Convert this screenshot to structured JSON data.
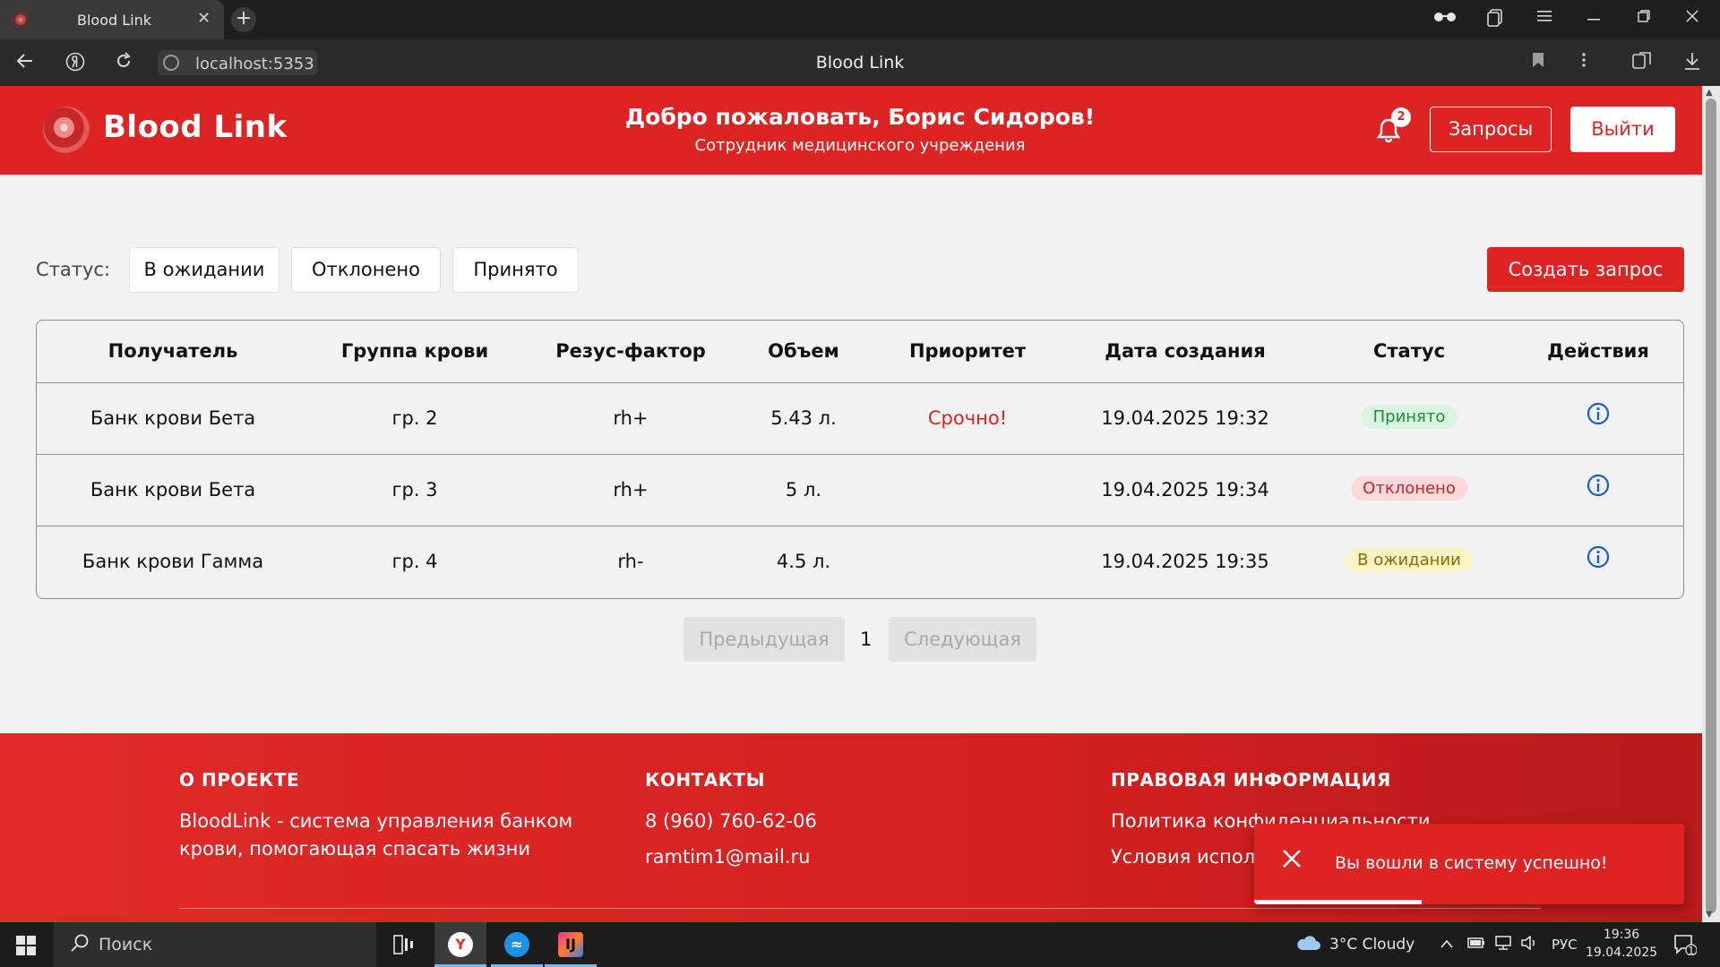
{
  "browser": {
    "tab_title": "Blood Link",
    "tab_close": "✕",
    "new_tab": "+",
    "url": "localhost:5353",
    "page_title": "Blood Link"
  },
  "header": {
    "brand": "Blood Link",
    "welcome": "Добро пожаловать, Борис Сидоров!",
    "role": "Сотрудник медицинского учреждения",
    "notification_count": "2",
    "requests_button": "Запросы",
    "logout_button": "Выйти"
  },
  "filters": {
    "label": "Статус:",
    "options": [
      "В ожидании",
      "Отклонено",
      "Принято"
    ],
    "create_button": "Создать запрос"
  },
  "table": {
    "columns": [
      "Получатель",
      "Группа крови",
      "Резус-фактор",
      "Объем",
      "Приоритет",
      "Дата создания",
      "Статус",
      "Действия"
    ],
    "rows": [
      {
        "recipient": "Банк крови Бета",
        "blood_group": "гр. 2",
        "rh": "rh+",
        "volume": "5.43 л.",
        "priority": "Срочно!",
        "created": "19.04.2025 19:32",
        "status": "Принято",
        "status_kind": "accepted"
      },
      {
        "recipient": "Банк крови Бета",
        "blood_group": "гр. 3",
        "rh": "rh+",
        "volume": "5 л.",
        "priority": "",
        "created": "19.04.2025 19:34",
        "status": "Отклонено",
        "status_kind": "rejected"
      },
      {
        "recipient": "Банк крови Гамма",
        "blood_group": "гр. 4",
        "rh": "rh-",
        "volume": "4.5 л.",
        "priority": "",
        "created": "19.04.2025 19:35",
        "status": "В ожидании",
        "status_kind": "pending"
      }
    ]
  },
  "pagination": {
    "prev": "Предыдущая",
    "page": "1",
    "next": "Следующая"
  },
  "footer": {
    "about_title": "О ПРОЕКТЕ",
    "about_line1": "BloodLink - система управления банком",
    "about_line2": "крови, помогающая спасать жизни",
    "contacts_title": "КОНТАКТЫ",
    "phone": "8 (960) 760-62-06",
    "email": "ramtim1@mail.ru",
    "legal_title": "ПРАВОВАЯ ИНФОРМАЦИЯ",
    "privacy": "Политика конфиденциальности",
    "terms": "Условия использования"
  },
  "toast": {
    "message": "Вы вошли в систему успешно!",
    "progress": 0.39
  },
  "taskbar": {
    "search_placeholder": "Поиск",
    "weather": "3°C  Cloudy",
    "language": "РУС",
    "time": "19:36",
    "date": "19.04.2025",
    "notification_count": "1"
  },
  "colors": {
    "brand_red": "#dc2424",
    "accepted": "#1e8a3c",
    "rejected": "#c0262c",
    "pending": "#8a6d00",
    "info_blue": "#1a5fd0"
  }
}
